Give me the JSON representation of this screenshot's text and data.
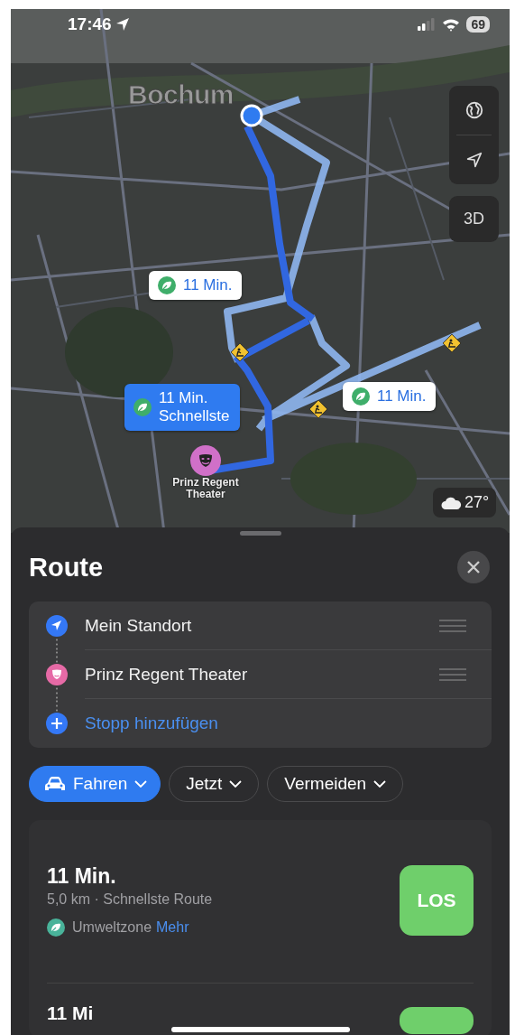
{
  "status_bar": {
    "time": "17:46",
    "battery": "69"
  },
  "map": {
    "city_label": "Bochum",
    "buttons": [
      {
        "kind": "globe"
      },
      {
        "kind": "locate"
      },
      {
        "kind": "text",
        "label": "3D"
      }
    ],
    "callouts": [
      {
        "time": "11 Min.",
        "selected": false
      },
      {
        "time": "11 Min.",
        "note": "Schnellste",
        "selected": true
      },
      {
        "time": "11 Min.",
        "selected": false
      }
    ],
    "destination_label": "Prinz Regent Theater",
    "weather": {
      "temperature": "27°"
    }
  },
  "sheet": {
    "title": "Route",
    "waypoints": [
      {
        "kind": "location",
        "label": "Mein Standort"
      },
      {
        "kind": "theater",
        "label": "Prinz Regent Theater"
      },
      {
        "kind": "add",
        "label": "Stopp hinzufügen"
      }
    ],
    "options": [
      {
        "kind": "drive",
        "label": "Fahren",
        "selected": true
      },
      {
        "kind": "filter",
        "label": "Jetzt",
        "selected": false
      },
      {
        "kind": "filter",
        "label": "Vermeiden",
        "selected": false
      }
    ],
    "routes": [
      {
        "time": "11 Min.",
        "details": "5,0 km · Schnellste Route",
        "zone": "Umweltzone",
        "zone_link": "Mehr",
        "button": "LOS"
      },
      {
        "time": "11 Mi"
      }
    ]
  }
}
